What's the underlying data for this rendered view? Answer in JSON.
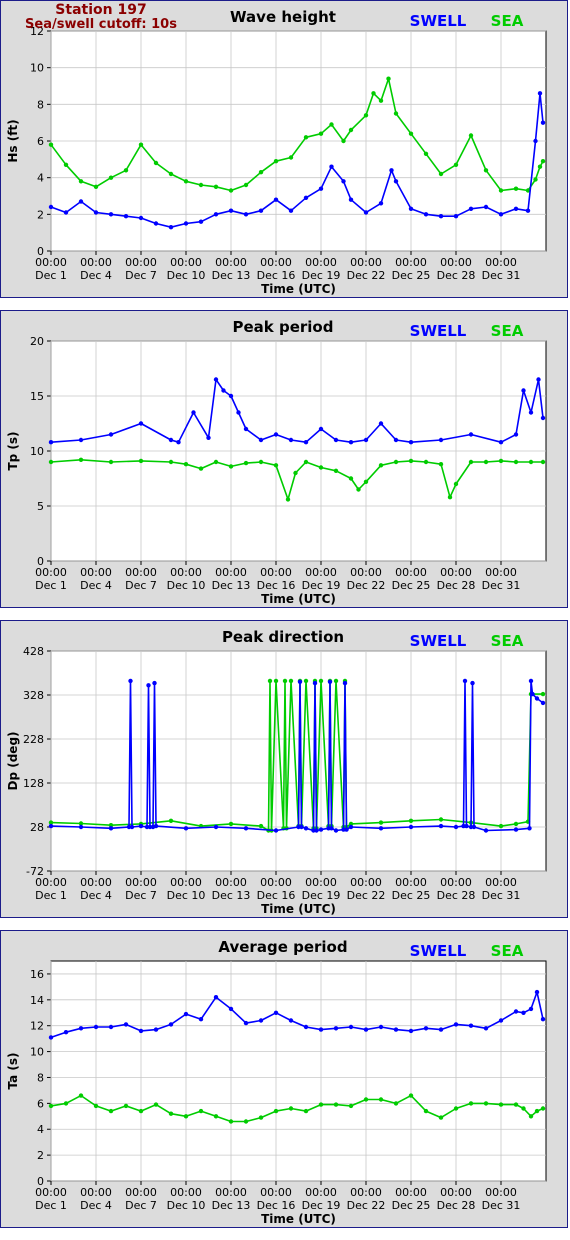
{
  "station": {
    "name": "Station 197",
    "cutoff": "Sea/swell cutoff: 10s"
  },
  "legend": {
    "swell_label": "SWELL",
    "sea_label": "SEA",
    "swell_color": "#0000ff",
    "sea_color": "#00cc00"
  },
  "chart_data": [
    {
      "type": "line",
      "title": "Wave height",
      "ylabel": "Hs (ft)",
      "xlabel": "Time (UTC)",
      "ylim": [
        0,
        12
      ],
      "yticks": [
        0,
        2,
        4,
        6,
        8,
        10,
        12
      ],
      "xlim": [
        0,
        33
      ],
      "xticks": [
        0,
        3,
        6,
        9,
        12,
        15,
        18,
        21,
        24,
        27,
        30
      ],
      "xtick_top": [
        "00:00",
        "00:00",
        "00:00",
        "00:00",
        "00:00",
        "00:00",
        "00:00",
        "00:00",
        "00:00",
        "00:00",
        "00:00"
      ],
      "xtick_bottom": [
        "Dec 1",
        "Dec 4",
        "Dec 7",
        "Dec 10",
        "Dec 13",
        "Dec 16",
        "Dec 19",
        "Dec 22",
        "Dec 25",
        "Dec 28",
        "Dec 31"
      ],
      "grid": true,
      "series": [
        {
          "name": "SWELL",
          "color": "#0000ff",
          "x": [
            0,
            1,
            2,
            3,
            4,
            5,
            6,
            7,
            8,
            9,
            10,
            11,
            12,
            13,
            14,
            15,
            16,
            17,
            18,
            18.7,
            19.5,
            20,
            21,
            22,
            22.7,
            23,
            24,
            25,
            26,
            27,
            28,
            29,
            30,
            31,
            31.8,
            32.3,
            32.6,
            32.8
          ],
          "y": [
            2.4,
            2.1,
            2.7,
            2.1,
            2.0,
            1.9,
            1.8,
            1.5,
            1.3,
            1.5,
            1.6,
            2.0,
            2.2,
            2.0,
            2.2,
            2.8,
            2.2,
            2.9,
            3.4,
            4.6,
            3.8,
            2.8,
            2.1,
            2.6,
            4.4,
            3.8,
            2.3,
            2.0,
            1.9,
            1.9,
            2.3,
            2.4,
            2.0,
            2.3,
            2.2,
            6.0,
            8.6,
            7.0
          ]
        },
        {
          "name": "SEA",
          "color": "#00cc00",
          "x": [
            0,
            1,
            2,
            3,
            4,
            5,
            6,
            7,
            8,
            9,
            10,
            11,
            12,
            13,
            14,
            15,
            16,
            17,
            18,
            18.7,
            19.5,
            20,
            21,
            21.5,
            22,
            22.5,
            23,
            24,
            25,
            26,
            27,
            28,
            29,
            30,
            31,
            31.8,
            32.3,
            32.6,
            32.8
          ],
          "y": [
            5.8,
            4.7,
            3.8,
            3.5,
            4.0,
            4.4,
            5.8,
            4.8,
            4.2,
            3.8,
            3.6,
            3.5,
            3.3,
            3.6,
            4.3,
            4.9,
            5.1,
            6.2,
            6.4,
            6.9,
            6.0,
            6.6,
            7.4,
            8.6,
            8.2,
            9.4,
            7.5,
            6.4,
            5.3,
            4.2,
            4.7,
            6.3,
            4.4,
            3.3,
            3.4,
            3.3,
            3.9,
            4.6,
            4.9
          ]
        }
      ]
    },
    {
      "type": "line",
      "title": "Peak period",
      "ylabel": "Tp (s)",
      "xlabel": "Time (UTC)",
      "ylim": [
        0,
        20
      ],
      "yticks": [
        0,
        5,
        10,
        15,
        20
      ],
      "xlim": [
        0,
        33
      ],
      "xticks": [
        0,
        3,
        6,
        9,
        12,
        15,
        18,
        21,
        24,
        27,
        30
      ],
      "xtick_top": [
        "00:00",
        "00:00",
        "00:00",
        "00:00",
        "00:00",
        "00:00",
        "00:00",
        "00:00",
        "00:00",
        "00:00",
        "00:00"
      ],
      "xtick_bottom": [
        "Dec 1",
        "Dec 4",
        "Dec 7",
        "Dec 10",
        "Dec 13",
        "Dec 16",
        "Dec 19",
        "Dec 22",
        "Dec 25",
        "Dec 28",
        "Dec 31"
      ],
      "grid": true,
      "series": [
        {
          "name": "SWELL",
          "color": "#0000ff",
          "x": [
            0,
            2,
            4,
            6,
            8,
            8.5,
            9.5,
            10.5,
            11,
            11.5,
            12,
            12.5,
            13,
            14,
            15,
            16,
            17,
            18,
            19,
            20,
            21,
            22,
            23,
            24,
            26,
            28,
            30,
            31,
            31.5,
            32,
            32.5,
            32.8
          ],
          "y": [
            10.8,
            11.0,
            11.5,
            12.5,
            11.0,
            10.8,
            13.5,
            11.2,
            16.5,
            15.5,
            15.0,
            13.5,
            12.0,
            11.0,
            11.5,
            11.0,
            10.8,
            12.0,
            11.0,
            10.8,
            11.0,
            12.5,
            11.0,
            10.8,
            11.0,
            11.5,
            10.8,
            11.5,
            15.5,
            13.5,
            16.5,
            13.0
          ]
        },
        {
          "name": "SEA",
          "color": "#00cc00",
          "x": [
            0,
            2,
            4,
            6,
            8,
            9,
            10,
            11,
            12,
            13,
            14,
            15,
            15.8,
            16.3,
            17,
            18,
            19,
            20,
            20.5,
            21,
            22,
            23,
            24,
            25,
            26,
            26.6,
            27,
            28,
            29,
            30,
            31,
            32,
            32.8
          ],
          "y": [
            9.0,
            9.2,
            9.0,
            9.1,
            9.0,
            8.8,
            8.4,
            9.0,
            8.6,
            8.9,
            9.0,
            8.7,
            5.6,
            8.0,
            9.0,
            8.5,
            8.2,
            7.5,
            6.5,
            7.2,
            8.7,
            9.0,
            9.1,
            9.0,
            8.8,
            5.8,
            7.0,
            9.0,
            9.0,
            9.1,
            9.0,
            9.0,
            9.0
          ]
        }
      ]
    },
    {
      "type": "line",
      "title": "Peak direction",
      "ylabel": "Dp (deg)",
      "xlabel": "Time (UTC)",
      "ylim": [
        -72,
        428
      ],
      "yticks": [
        -72,
        28,
        128,
        228,
        328,
        428
      ],
      "xlim": [
        0,
        33
      ],
      "xticks": [
        0,
        3,
        6,
        9,
        12,
        15,
        18,
        21,
        24,
        27,
        30
      ],
      "xtick_top": [
        "00:00",
        "00:00",
        "00:00",
        "00:00",
        "00:00",
        "00:00",
        "00:00",
        "00:00",
        "00:00",
        "00:00",
        "00:00"
      ],
      "xtick_bottom": [
        "Dec 1",
        "Dec 4",
        "Dec 7",
        "Dec 10",
        "Dec 13",
        "Dec 16",
        "Dec 19",
        "Dec 22",
        "Dec 25",
        "Dec 28",
        "Dec 31"
      ],
      "grid": true,
      "series": [
        {
          "name": "SWELL",
          "color": "#0000ff",
          "x": [
            0,
            2,
            4,
            5.2,
            5.3,
            5.4,
            6,
            6.4,
            6.5,
            6.6,
            6.8,
            6.9,
            7,
            9,
            11,
            13,
            15,
            16.5,
            16.6,
            16.7,
            17,
            17.5,
            17.6,
            17.7,
            18,
            18.5,
            18.6,
            18.7,
            19,
            19.5,
            19.6,
            19.7,
            20,
            22,
            24,
            26,
            27,
            27.5,
            27.6,
            27.7,
            28,
            28.1,
            28.2,
            29,
            31,
            31.9,
            32,
            32.1,
            32.4,
            32.8
          ],
          "y": [
            30,
            28,
            25,
            28,
            360,
            28,
            30,
            28,
            350,
            28,
            28,
            355,
            30,
            25,
            28,
            25,
            20,
            28,
            358,
            28,
            25,
            20,
            355,
            20,
            22,
            25,
            358,
            25,
            20,
            22,
            355,
            22,
            28,
            25,
            28,
            30,
            28,
            30,
            360,
            30,
            28,
            355,
            28,
            20,
            22,
            25,
            360,
            330,
            320,
            310
          ]
        },
        {
          "name": "SEA",
          "color": "#00cc00",
          "x": [
            0,
            2,
            4,
            6,
            8,
            10,
            12,
            14,
            14.5,
            14.6,
            14.7,
            15,
            15.5,
            15.6,
            15.7,
            16,
            16.5,
            16.6,
            16.7,
            17,
            17.5,
            17.6,
            17.7,
            18,
            18.5,
            18.6,
            18.7,
            19,
            19.5,
            19.6,
            19.7,
            20,
            22,
            24,
            26,
            28,
            30,
            31,
            31.8,
            32,
            32.8
          ],
          "y": [
            38,
            36,
            32,
            35,
            42,
            30,
            35,
            30,
            20,
            360,
            20,
            360,
            25,
            360,
            25,
            360,
            30,
            360,
            30,
            360,
            25,
            360,
            25,
            360,
            30,
            360,
            30,
            360,
            28,
            360,
            28,
            35,
            38,
            42,
            45,
            38,
            30,
            35,
            40,
            330,
            330
          ]
        }
      ]
    },
    {
      "type": "line",
      "title": "Average period",
      "ylabel": "Ta (s)",
      "xlabel": "Time (UTC)",
      "ylim": [
        0,
        17
      ],
      "yticks": [
        0,
        2,
        4,
        6,
        8,
        10,
        12,
        14,
        16
      ],
      "xlim": [
        0,
        33
      ],
      "xticks": [
        0,
        3,
        6,
        9,
        12,
        15,
        18,
        21,
        24,
        27,
        30
      ],
      "xtick_top": [
        "00:00",
        "00:00",
        "00:00",
        "00:00",
        "00:00",
        "00:00",
        "00:00",
        "00:00",
        "00:00",
        "00:00",
        "00:00"
      ],
      "xtick_bottom": [
        "Dec 1",
        "Dec 4",
        "Dec 7",
        "Dec 10",
        "Dec 13",
        "Dec 16",
        "Dec 19",
        "Dec 22",
        "Dec 25",
        "Dec 28",
        "Dec 31"
      ],
      "grid": true,
      "series": [
        {
          "name": "SWELL",
          "color": "#0000ff",
          "x": [
            0,
            1,
            2,
            3,
            4,
            5,
            6,
            7,
            8,
            9,
            10,
            11,
            12,
            13,
            14,
            15,
            16,
            17,
            18,
            19,
            20,
            21,
            22,
            23,
            24,
            25,
            26,
            27,
            28,
            29,
            30,
            31,
            31.5,
            32,
            32.4,
            32.8
          ],
          "y": [
            11.1,
            11.5,
            11.8,
            11.9,
            11.9,
            12.1,
            11.6,
            11.7,
            12.1,
            12.9,
            12.5,
            14.2,
            13.3,
            12.2,
            12.4,
            13.0,
            12.4,
            11.9,
            11.7,
            11.8,
            11.9,
            11.7,
            11.9,
            11.7,
            11.6,
            11.8,
            11.7,
            12.1,
            12.0,
            11.8,
            12.4,
            13.1,
            13.0,
            13.3,
            14.6,
            12.5
          ]
        },
        {
          "name": "SEA",
          "color": "#00cc00",
          "x": [
            0,
            1,
            2,
            3,
            4,
            5,
            6,
            7,
            8,
            9,
            10,
            11,
            12,
            13,
            14,
            15,
            16,
            17,
            18,
            19,
            20,
            21,
            22,
            23,
            24,
            25,
            26,
            27,
            28,
            29,
            30,
            31,
            31.5,
            32,
            32.4,
            32.8
          ],
          "y": [
            5.8,
            6.0,
            6.6,
            5.8,
            5.4,
            5.8,
            5.4,
            5.9,
            5.2,
            5.0,
            5.4,
            5.0,
            4.6,
            4.6,
            4.9,
            5.4,
            5.6,
            5.4,
            5.9,
            5.9,
            5.8,
            6.3,
            6.3,
            6.0,
            6.6,
            5.4,
            4.9,
            5.6,
            6.0,
            6.0,
            5.9,
            5.9,
            5.6,
            5.0,
            5.4,
            5.6
          ]
        }
      ]
    }
  ]
}
